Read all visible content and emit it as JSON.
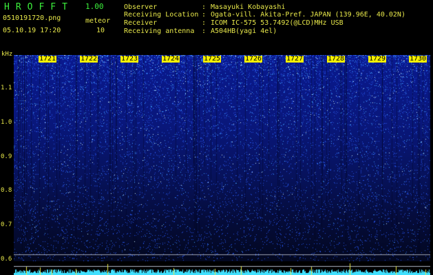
{
  "app": {
    "title": "HROFFT",
    "version": "1.00"
  },
  "file": {
    "name": "0510191720.png",
    "timestamp": "05.10.19 17:20"
  },
  "meteor": {
    "label": "meteor",
    "count": "10"
  },
  "info": [
    {
      "label": "Observer",
      "value": "Masayuki Kobayashi"
    },
    {
      "label": "Receiving Location",
      "value": "Ogata-vill. Akita-Pref. JAPAN (139.96E, 40.02N)"
    },
    {
      "label": "Receiver",
      "value": "ICOM IC-575 53.7492(@LCD)MHz USB"
    },
    {
      "label": "Receiving antenna",
      "value": "A504HB(yagi 4el)"
    }
  ],
  "chart_data": {
    "type": "heatmap",
    "ylabel": "kHz",
    "yticks": [
      "1.1",
      "1.0",
      "0.9",
      "0.8",
      "0.7",
      "0.6"
    ],
    "xticks": [
      "1721",
      "1722",
      "1723",
      "1724",
      "1725",
      "1726",
      "1727",
      "1728",
      "1729",
      "1730"
    ],
    "colors": {
      "background": "#000000",
      "header_green": "#3cf03c",
      "text_yellow": "#e8e84a",
      "tick_bg": "#f6f000",
      "spectrum_blue": "#0a1a8c",
      "activity_cyan": "#40e0ff"
    }
  }
}
